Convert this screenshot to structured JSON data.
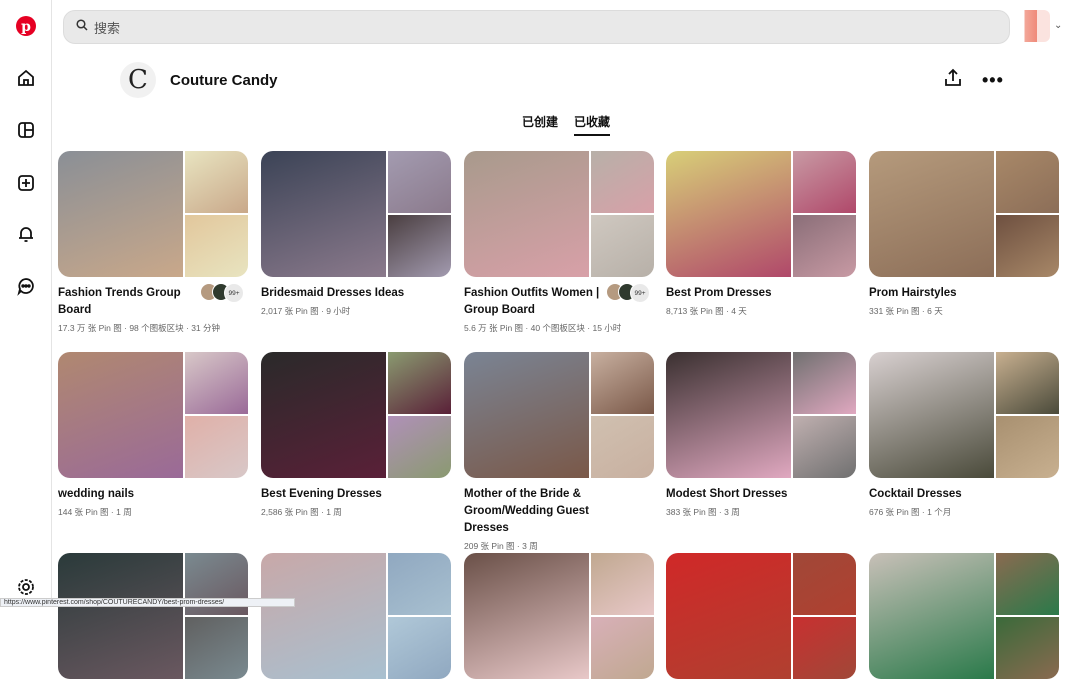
{
  "search": {
    "placeholder": "搜索"
  },
  "profile": {
    "logo_letter": "C",
    "name": "Couture Candy"
  },
  "tabs": [
    {
      "label": "已创建"
    },
    {
      "label": "已收藏"
    }
  ],
  "boards": [
    {
      "title": "Fashion Trends Group Board",
      "meta": "17.3 万 张 Pin 图 · 98 个图板区块 · 31 分钟",
      "collab": "99+",
      "colors": [
        "#8a8f96",
        "#c9a88a",
        "#e8e4c0",
        "#e2c79c"
      ]
    },
    {
      "title": "Bridesmaid Dresses Ideas",
      "meta": "2,017 张 Pin 图 · 9 小时",
      "colors": [
        "#3b4356",
        "#8b7a8c",
        "#a39bb0",
        "#4a3e40"
      ]
    },
    {
      "title": "Fashion Outfits Women | Group Board",
      "meta": "5.6 万 张 Pin 图 · 40 个图板区块 · 15 小时",
      "collab": "99+",
      "colors": [
        "#a89a8c",
        "#d8a0a8",
        "#b7b0a8",
        "#cfc8c0"
      ]
    },
    {
      "title": "Best Prom Dresses",
      "meta": "8,713 张 Pin 图 · 4 天",
      "colors": [
        "#d8cf78",
        "#b0486a",
        "#c89aa4",
        "#8a6e78"
      ]
    },
    {
      "title": "Prom Hairstyles",
      "meta": "331 张 Pin 图 · 6 天",
      "colors": [
        "#b59a7c",
        "#8c6e58",
        "#a88868",
        "#6e5040"
      ]
    },
    {
      "title": "wedding nails",
      "meta": "144 张 Pin 图 · 1 周",
      "colors": [
        "#b08870",
        "#9a6a98",
        "#d8c8c8",
        "#e0b0a8"
      ]
    },
    {
      "title": "Best Evening Dresses",
      "meta": "2,586 张 Pin 图 · 1 周",
      "colors": [
        "#2a2a2a",
        "#5a2038",
        "#8a9a70",
        "#b090b8"
      ]
    },
    {
      "title": "Mother of the Bride & Groom/Wedding Guest Dresses",
      "meta": "209 张 Pin 图 · 3 周",
      "colors": [
        "#7a8494",
        "#7a5848",
        "#c8b0a0",
        "#d0c0b0"
      ]
    },
    {
      "title": "Modest Short Dresses",
      "meta": "383 张 Pin 图 · 3 周",
      "colors": [
        "#3a3030",
        "#e0a8c0",
        "#707070",
        "#c0b0b0"
      ]
    },
    {
      "title": "Cocktail Dresses",
      "meta": "676 张 Pin 图 · 1 个月",
      "colors": [
        "#d8d0d0",
        "#4a4a3a",
        "#c8b090",
        "#a89070"
      ]
    },
    {
      "title": "",
      "meta": "",
      "colors": [
        "#2a3a3a",
        "#6a5860",
        "#7a8a90",
        "#606060"
      ]
    },
    {
      "title": "",
      "meta": "",
      "colors": [
        "#c8a8a8",
        "#a8c0d0",
        "#90a8c0",
        "#b0c8d8"
      ]
    },
    {
      "title": "",
      "meta": "",
      "colors": [
        "#6a5048",
        "#e8c8c8",
        "#c0a890",
        "#d8b0b8"
      ]
    },
    {
      "title": "",
      "meta": "",
      "colors": [
        "#d02828",
        "#b04030",
        "#a04838",
        "#c83030"
      ]
    },
    {
      "title": "",
      "meta": "",
      "colors": [
        "#c8c0b8",
        "#2a7a4a",
        "#8a6a50",
        "#3a6a3a"
      ]
    }
  ],
  "status_url": "https://www.pinterest.com/shop/COUTURECANDY/best-prom-dresses/"
}
